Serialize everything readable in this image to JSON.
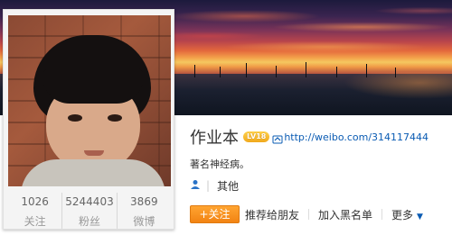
{
  "profile": {
    "name": "作业本",
    "level_badge": "LV18",
    "url": "http://weibo.com/314117444",
    "bio": "著名神经病。",
    "category": "其他"
  },
  "stats": [
    {
      "value": "1026",
      "label": "关注"
    },
    {
      "value": "5244403",
      "label": "粉丝"
    },
    {
      "value": "3869",
      "label": "微博"
    }
  ],
  "actions": {
    "follow_label": "+关注",
    "recommend_label": "推荐给朋友",
    "blacklist_label": "加入黑名单",
    "more_label": "更多"
  },
  "icons": {
    "url": "link-icon",
    "user": "user-icon",
    "more": "caret-down-icon"
  },
  "colors": {
    "follow_button": "#f28313",
    "link": "#0a5bb3",
    "level_badge": "#f0a81c"
  }
}
